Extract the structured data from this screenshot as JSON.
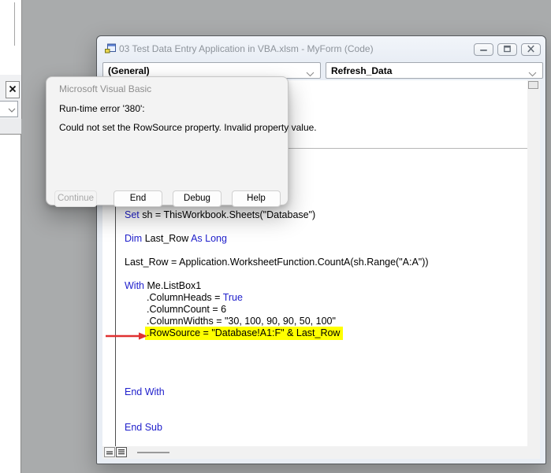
{
  "page": {
    "background": "#a9abac"
  },
  "icons": {
    "form-icon": "▣",
    "minimize-icon": "–",
    "restore-icon": "❐",
    "close-icon": "✕",
    "chevron-down-icon": "⌄",
    "procedure-view-icon": "≡",
    "full-module-view-icon": "≣"
  },
  "code_window": {
    "title": "03 Test Data Entry Application in VBA.xlsm - MyForm (Code)",
    "object_dropdown": "(General)",
    "procedure_dropdown": "Refresh_Data",
    "colors": {
      "keyword": "#2121cc",
      "text": "#000000",
      "highlight": "#ffff00",
      "arrow": "#e03131"
    },
    "code_lines": [
      {
        "indent": 0,
        "hl": false,
        "tokens": [
          [
            "Set",
            "k"
          ],
          [
            " sh = ThisWorkbook.Sheets(\"Database\")",
            "n"
          ]
        ]
      },
      {
        "tokens": []
      },
      {
        "indent": 0,
        "hl": false,
        "tokens": [
          [
            "Dim",
            "k"
          ],
          [
            " Last_Row ",
            "n"
          ],
          [
            "As Long",
            "k"
          ]
        ]
      },
      {
        "tokens": []
      },
      {
        "indent": 0,
        "hl": false,
        "tokens": [
          [
            "Last_Row = Application.WorksheetFunction.CountA(sh.Range(\"A:A\"))",
            "n"
          ]
        ]
      },
      {
        "tokens": []
      },
      {
        "indent": 0,
        "hl": false,
        "tokens": [
          [
            "With",
            "k"
          ],
          [
            " Me.ListBox1",
            "n"
          ]
        ]
      },
      {
        "indent": 1,
        "hl": false,
        "tokens": [
          [
            ".ColumnHeads = ",
            "n"
          ],
          [
            "True",
            "k"
          ]
        ]
      },
      {
        "indent": 1,
        "hl": false,
        "tokens": [
          [
            ".ColumnCount = 6",
            "n"
          ]
        ]
      },
      {
        "indent": 1,
        "hl": false,
        "tokens": [
          [
            ".ColumnWidths = \"30, 100, 90, 90, 50, 100\"",
            "n"
          ]
        ]
      },
      {
        "indent": 1,
        "hl": true,
        "tokens": [
          [
            ".RowSource = \"Database!A1:F\" & Last_Row",
            "n"
          ]
        ]
      },
      {
        "tokens": []
      },
      {
        "tokens": []
      },
      {
        "tokens": []
      },
      {
        "tokens": []
      },
      {
        "indent": 0,
        "hl": false,
        "tokens": [
          [
            "End With",
            "k"
          ]
        ]
      },
      {
        "tokens": []
      },
      {
        "tokens": []
      },
      {
        "indent": 0,
        "hl": false,
        "tokens": [
          [
            "End Sub",
            "k"
          ]
        ]
      }
    ]
  },
  "error_dialog": {
    "title": "Microsoft Visual Basic",
    "message_line1": "Run-time error '380':",
    "message_line2": "Could not set the RowSource property. Invalid property value.",
    "buttons": [
      {
        "label": "Continue",
        "enabled": false
      },
      {
        "label": "End",
        "enabled": true
      },
      {
        "label": "Debug",
        "enabled": true
      },
      {
        "label": "Help",
        "enabled": true
      }
    ]
  }
}
